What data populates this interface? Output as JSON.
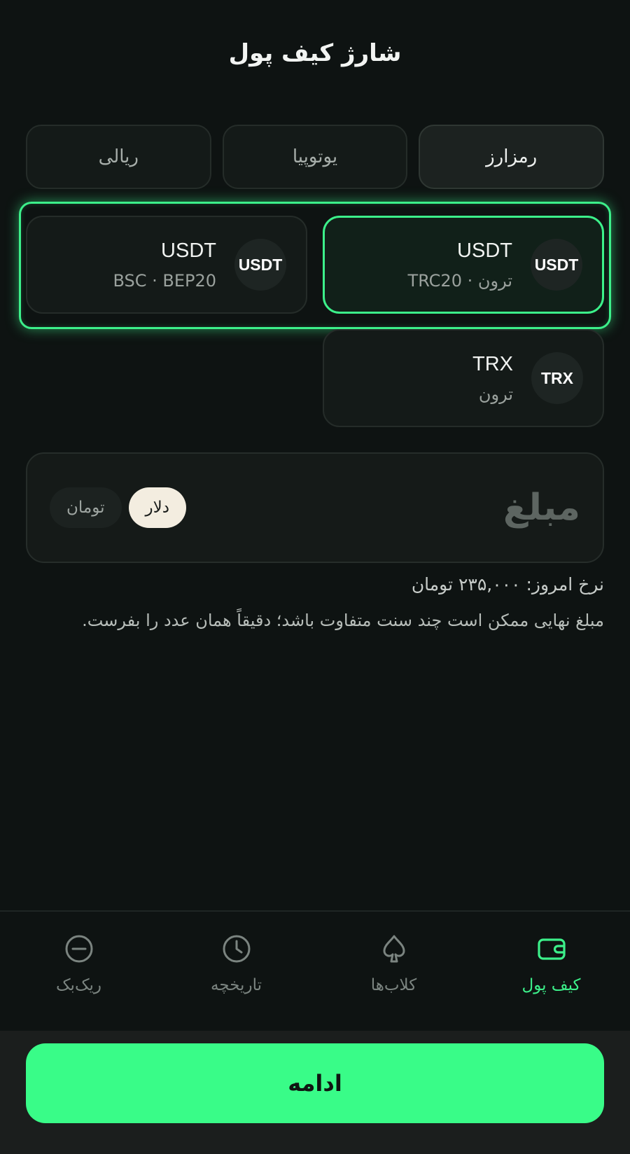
{
  "header": {
    "title": "شارژ کیف پول"
  },
  "tabs": [
    {
      "label": "رمزارز",
      "active": true
    },
    {
      "label": "یوتوپیا",
      "active": false
    },
    {
      "label": "ریالی",
      "active": false
    }
  ],
  "coins": [
    {
      "badge": "USDT",
      "name": "USDT",
      "network": "ترون · TRC20",
      "active": true
    },
    {
      "badge": "USDT",
      "name": "USDT",
      "network": "BSC · BEP20",
      "active": false
    },
    {
      "badge": "TRX",
      "name": "TRX",
      "network": "ترون",
      "active": false
    }
  ],
  "amount": {
    "placeholder": "مبلغ",
    "currencies": [
      {
        "label": "دلار",
        "active": true
      },
      {
        "label": "تومان",
        "active": false
      }
    ]
  },
  "rate_text": "نرخ امروز: ۲۳۵,۰۰۰ تومان",
  "note_text": "مبلغ نهایی ممکن است چند سنت متفاوت باشد؛ دقیقاً همان عدد را بفرست.",
  "nav": [
    {
      "label": "کیف پول",
      "icon": "wallet-icon",
      "active": true
    },
    {
      "label": "کلاب‌ها",
      "icon": "spade-icon",
      "active": false
    },
    {
      "label": "تاریخچه",
      "icon": "clock-icon",
      "active": false
    },
    {
      "label": "ریک‌بک",
      "icon": "minus-circle-icon",
      "active": false
    }
  ],
  "colors": {
    "accent": "#3cf08a",
    "button": "#39fc88",
    "background": "#0e1312"
  },
  "footer": {
    "continue_label": "ادامه"
  }
}
